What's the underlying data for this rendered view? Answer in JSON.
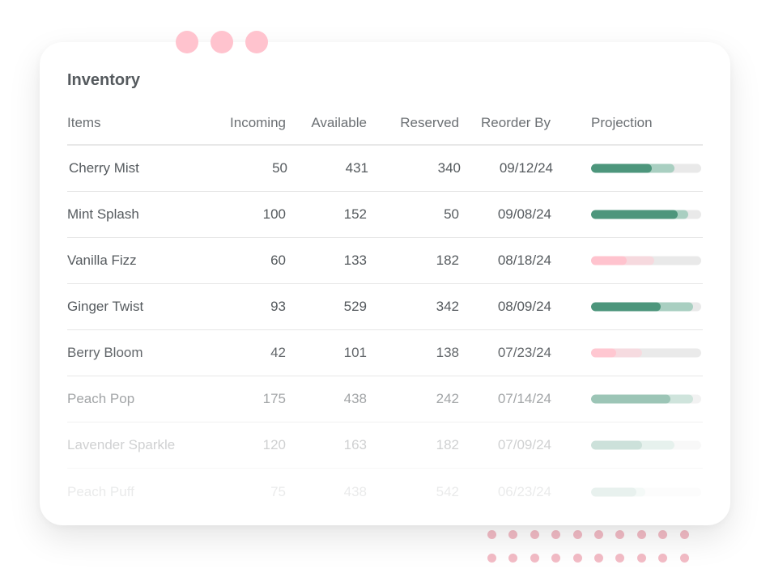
{
  "title": "Inventory",
  "columns": {
    "items": "Items",
    "incoming": "Incoming",
    "available": "Available",
    "reserved": "Reserved",
    "reorder_by": "Reorder By",
    "projection": "Projection"
  },
  "rows": [
    {
      "name": "Cherry Mist",
      "incoming": "50",
      "available": "431",
      "reserved": "340",
      "reorder_by": "09/12/24",
      "status": "good",
      "projection_current": 0.55,
      "projection_total": 0.76
    },
    {
      "name": "Mint Splash",
      "incoming": "100",
      "available": "152",
      "reserved": "50",
      "reorder_by": "09/08/24",
      "status": "good",
      "projection_current": 0.79,
      "projection_total": 0.88
    },
    {
      "name": "Vanilla Fizz",
      "incoming": "60",
      "available": "133",
      "reserved": "182",
      "reorder_by": "08/18/24",
      "status": "low",
      "projection_current": 0.32,
      "projection_total": 0.57
    },
    {
      "name": "Ginger Twist",
      "incoming": "93",
      "available": "529",
      "reserved": "342",
      "reorder_by": "08/09/24",
      "status": "good",
      "projection_current": 0.63,
      "projection_total": 0.93
    },
    {
      "name": "Berry Bloom",
      "incoming": "42",
      "available": "101",
      "reserved": "138",
      "reorder_by": "07/23/24",
      "status": "low",
      "projection_current": 0.23,
      "projection_total": 0.46
    },
    {
      "name": "Peach Pop",
      "incoming": "175",
      "available": "438",
      "reserved": "242",
      "reorder_by": "07/14/24",
      "status": "good",
      "projection_current": 0.72,
      "projection_total": 0.93
    },
    {
      "name": "Lavender Sparkle",
      "incoming": "120",
      "available": "163",
      "reserved": "182",
      "reorder_by": "07/09/24",
      "status": "good",
      "projection_current": 0.46,
      "projection_total": 0.76
    },
    {
      "name": "Peach Puff",
      "incoming": "75",
      "available": "438",
      "reserved": "542",
      "reorder_by": "06/23/24",
      "status": "good",
      "projection_current": 0.41,
      "projection_total": 0.49
    }
  ],
  "colors": {
    "good_current": "#4d967c",
    "good_projection": "#a9cfc1",
    "low_current": "#ffc3ce",
    "low_projection": "#f6d9de",
    "accent_pink": "#ffc3ce"
  }
}
